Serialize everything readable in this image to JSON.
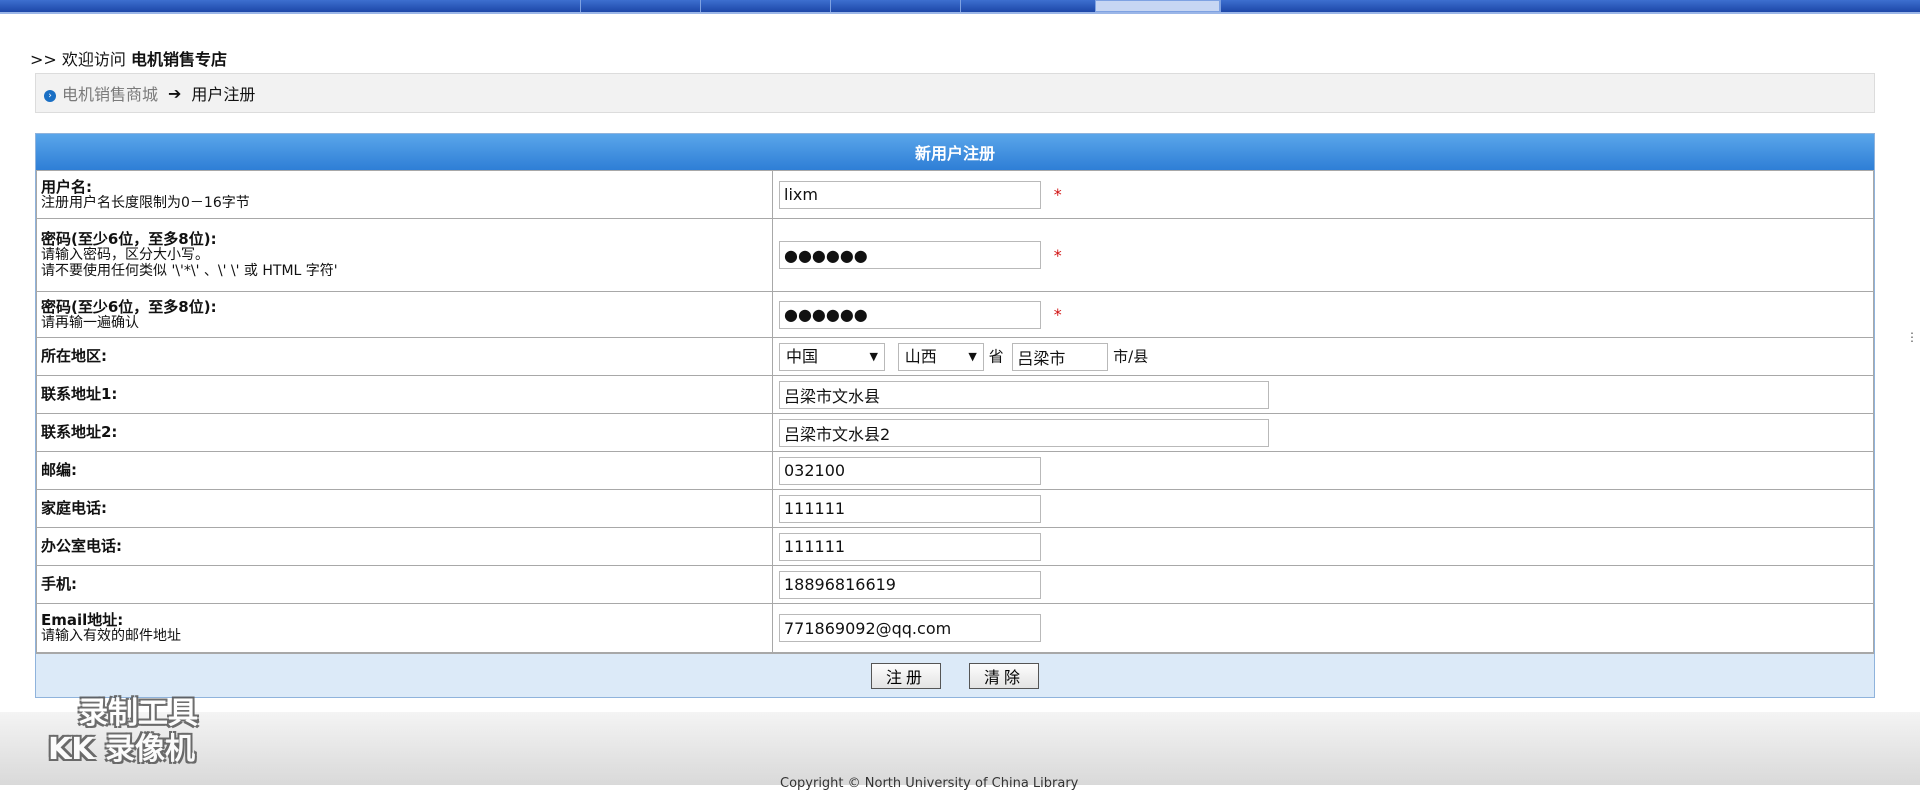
{
  "welcome": {
    "prefix": ">> 欢迎访问 ",
    "shop_name": "电机销售专店"
  },
  "breadcrumb": {
    "home": "电机销售商城",
    "arrow": "➔",
    "current": "用户注册"
  },
  "form": {
    "title": "新用户注册",
    "username": {
      "label": "用户名:",
      "hint": "注册用户名长度限制为0－16字节",
      "value": "lixm",
      "required_mark": "*"
    },
    "password": {
      "label": "密码(至少6位，至多8位):",
      "hint1": "请输入密码，区分大小写。",
      "hint2": "请不要使用任何类似 '\\'*\\' 、\\' \\' 或 HTML 字符'",
      "value": "●●●●●●",
      "required_mark": "*"
    },
    "password_confirm": {
      "label": "密码(至少6位，至多8位):",
      "hint": "请再输一遍确认",
      "value": "●●●●●●",
      "required_mark": "*"
    },
    "region": {
      "label": "所在地区:",
      "country": "中国",
      "province": "山西",
      "province_suffix": "省",
      "city": "吕梁市",
      "city_suffix": "市/县"
    },
    "address1": {
      "label": "联系地址1:",
      "value": "吕梁市文水县"
    },
    "address2": {
      "label": "联系地址2:",
      "value": "吕梁市文水县2"
    },
    "zipcode": {
      "label": "邮编:",
      "value": "032100"
    },
    "home_phone": {
      "label": "家庭电话:",
      "value": "111111"
    },
    "office_phone": {
      "label": "办公室电话:",
      "value": "111111"
    },
    "mobile": {
      "label": "手机:",
      "value": "18896816619"
    },
    "email": {
      "label": "Email地址:",
      "hint": "请输入有效的邮件地址",
      "value": "771869092@qq.com"
    },
    "submit_label": "注册",
    "reset_label": "清除"
  },
  "footer": {
    "copyright": "Copyright © North University of China Library"
  },
  "watermark": {
    "line1": "录制工具",
    "line2": "KK 录像机"
  },
  "colors": {
    "header_blue": "#2e7ed6",
    "topbar_blue": "#1d47a8",
    "required_red": "#d01010"
  }
}
